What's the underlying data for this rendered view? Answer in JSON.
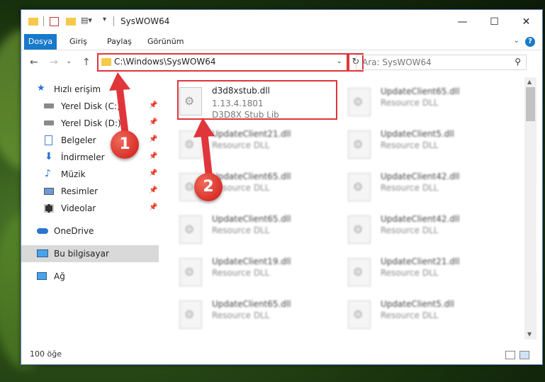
{
  "title_bar": {
    "title": "SysWOW64",
    "minimize": "—",
    "maximize": "☐",
    "close": "✕"
  },
  "ribbon": {
    "tabs": [
      {
        "label": "Dosya",
        "active": true
      },
      {
        "label": "Giriş",
        "active": false
      },
      {
        "label": "Paylaş",
        "active": false
      },
      {
        "label": "Görünüm",
        "active": false
      }
    ],
    "help": "?"
  },
  "navigation": {
    "back": "←",
    "forward": "→",
    "recent": "⌄",
    "up": "↑",
    "address": "C:\\Windows\\SysWOW64",
    "dropdown": "⌄",
    "refresh": "↻",
    "search_placeholder": "Ara: SysWOW64"
  },
  "sidebar": {
    "items": [
      {
        "label": "Hızlı erişim",
        "icon": "star-icon",
        "pinned": false
      },
      {
        "label": "Yerel Disk (C:)",
        "icon": "drive-icon",
        "pinned": true
      },
      {
        "label": "Yerel Disk (D:)",
        "icon": "drive-icon",
        "pinned": true
      },
      {
        "label": "Belgeler",
        "icon": "document-icon",
        "pinned": true
      },
      {
        "label": "İndirmeler",
        "icon": "download-icon",
        "pinned": true
      },
      {
        "label": "Müzik",
        "icon": "music-icon",
        "pinned": true
      },
      {
        "label": "Resimler",
        "icon": "picture-icon",
        "pinned": true
      },
      {
        "label": "Videolar",
        "icon": "video-icon",
        "pinned": true
      },
      {
        "label": "OneDrive",
        "icon": "cloud-icon",
        "pinned": false
      },
      {
        "label": "Bu bilgisayar",
        "icon": "computer-icon",
        "pinned": false,
        "selected": true
      },
      {
        "label": "Ağ",
        "icon": "network-icon",
        "pinned": false
      }
    ]
  },
  "files": [
    {
      "name": "d3d8xstub.dll",
      "version": "1.13.4.1801",
      "description": "D3D8X Stub Lib",
      "highlighted": true
    },
    {
      "name": "UpdateClient65.dll",
      "description": "Resource DLL"
    },
    {
      "name": "UpdateClient21.dll",
      "description": "Resource DLL"
    },
    {
      "name": "UpdateClient5.dll",
      "description": "Resource DLL"
    },
    {
      "name": "UpdateClient65.dll",
      "description": "Resource DLL"
    },
    {
      "name": "UpdateClient42.dll",
      "description": "Resource DLL"
    },
    {
      "name": "UpdateClient65.dll",
      "description": "Resource DLL"
    },
    {
      "name": "UpdateClient42.dll",
      "description": "Resource DLL"
    },
    {
      "name": "UpdateClient19.dll",
      "description": "Resource DLL"
    },
    {
      "name": "UpdateClient21.dll",
      "description": "Resource DLL"
    },
    {
      "name": "UpdateClient65.dll",
      "description": "Resource DLL"
    },
    {
      "name": "UpdateClient5.dll",
      "description": "Resource DLL"
    }
  ],
  "status": {
    "item_count": "100 öğe"
  },
  "annotations": {
    "step1": "1",
    "step2": "2",
    "color": "#e0353b"
  }
}
